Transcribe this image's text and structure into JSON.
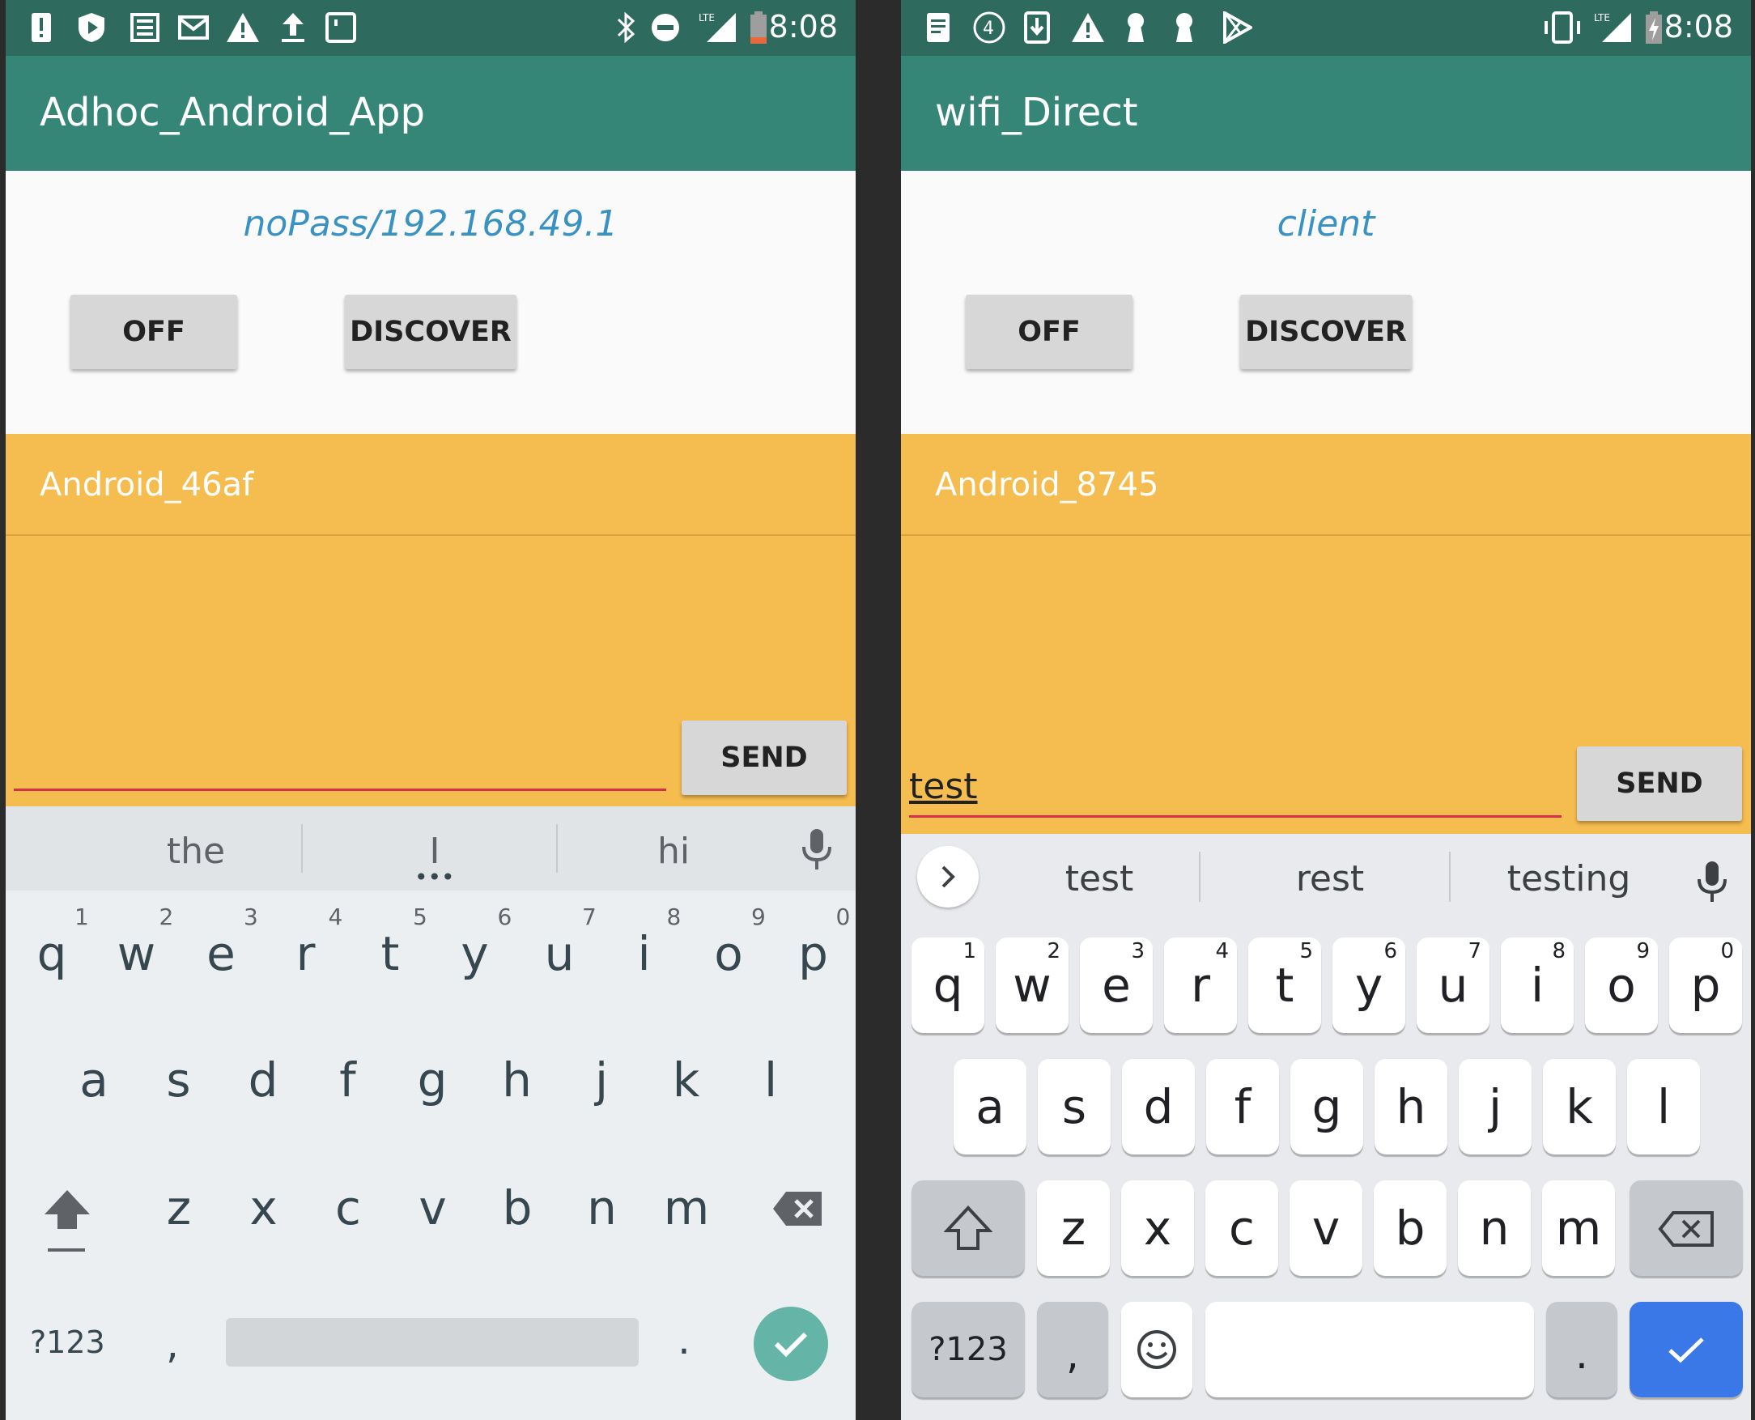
{
  "status_bar": {
    "time": "8:08",
    "network": "LTE"
  },
  "left_app": {
    "title": "Adhoc_Android_App",
    "connection_info": "noPass/192.168.49.1",
    "off_label": "OFF",
    "discover_label": "DISCOVER",
    "peer_name": "Android_46af",
    "message_value": "",
    "send_label": "SEND"
  },
  "right_app": {
    "title": "wifi_Direct",
    "connection_info": "client",
    "off_label": "OFF",
    "discover_label": "DISCOVER",
    "peer_name": "Android_8745",
    "message_value": "test",
    "send_label": "SEND"
  },
  "keyboard_left": {
    "suggestions": [
      "the",
      "I",
      "hi"
    ],
    "row1": [
      "q",
      "w",
      "e",
      "r",
      "t",
      "y",
      "u",
      "i",
      "o",
      "p"
    ],
    "row1_hints": [
      "1",
      "2",
      "3",
      "4",
      "5",
      "6",
      "7",
      "8",
      "9",
      "0"
    ],
    "row2": [
      "a",
      "s",
      "d",
      "f",
      "g",
      "h",
      "j",
      "k",
      "l"
    ],
    "row3": [
      "z",
      "x",
      "c",
      "v",
      "b",
      "n",
      "m"
    ],
    "symbols_label": "?123",
    "comma": ",",
    "period": "."
  },
  "keyboard_right": {
    "suggestions": [
      "test",
      "rest",
      "testing"
    ],
    "row1": [
      "q",
      "w",
      "e",
      "r",
      "t",
      "y",
      "u",
      "i",
      "o",
      "p"
    ],
    "row1_hints": [
      "1",
      "2",
      "3",
      "4",
      "5",
      "6",
      "7",
      "8",
      "9",
      "0"
    ],
    "row2": [
      "a",
      "s",
      "d",
      "f",
      "g",
      "h",
      "j",
      "k",
      "l"
    ],
    "row3": [
      "z",
      "x",
      "c",
      "v",
      "b",
      "n",
      "m"
    ],
    "symbols_label": "?123",
    "comma": ",",
    "period": "."
  },
  "colors": {
    "status_bar": "#2e6b5e",
    "app_bar": "#368677",
    "peer_area": "#f5bc4f",
    "accent_text": "#3a92c2",
    "underline": "#d6304a",
    "enter_key_left": "#64b5a7",
    "enter_key_right": "#3b78e7"
  },
  "icons": [
    "alert-icon",
    "shield-play-icon",
    "news-icon",
    "gmail-icon",
    "warning-icon",
    "upload-icon",
    "screen-icon",
    "bluetooth-icon",
    "dnd-icon",
    "signal-icon",
    "battery-icon",
    "notes-icon",
    "timer-icon",
    "download-icon",
    "keyhole-icon",
    "play-store-icon",
    "vibrate-icon",
    "charging-battery-icon",
    "mic-icon",
    "shift-icon",
    "backspace-icon",
    "emoji-icon",
    "check-icon",
    "expand-arrow-icon"
  ]
}
